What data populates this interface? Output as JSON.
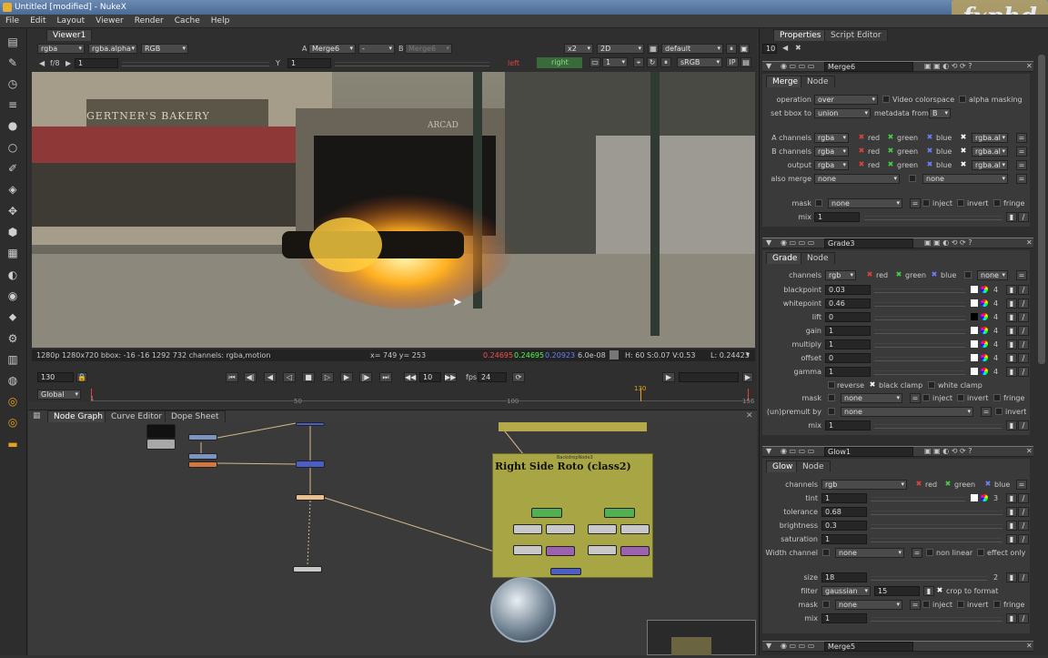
{
  "title": "Untitled [modified] - NukeX",
  "menu": [
    "File",
    "Edit",
    "Layout",
    "Viewer",
    "Render",
    "Cache",
    "Help"
  ],
  "watermark": "fxphd",
  "viewer": {
    "tab": "Viewer1",
    "channels": "rgba",
    "alpha": "rgba.alpha",
    "display": "RGB",
    "a_label": "A",
    "a_input": "Merge6",
    "b_dash": "-",
    "b_label": "B",
    "b_input": "Merge6",
    "zoom": "x2",
    "mode": "2D",
    "lut": "default",
    "fstop": "f/8",
    "frame_field": "1",
    "y_label": "Y",
    "y_value": "1",
    "left_eye": "left",
    "right_eye": "right",
    "frame_step": "1",
    "colorspace": "sRGB",
    "ip_label": "IP",
    "status_format": "1280p 1280x720 bbox: -16 -16 1292 732 channels: rgba,motion",
    "status_coords": "x= 749 y= 253",
    "status_r": "0.24695",
    "status_g": "0.24695",
    "status_b": "0.20923",
    "status_a": "6.0e-08",
    "status_hsv": "H: 60 S:0.07 V:0.53",
    "status_l": "L: 0.24423",
    "sign_text": "GERTNER'S BAKERY",
    "arcade_text": "ARCAD"
  },
  "timeline": {
    "frame": "130",
    "step": "10",
    "fps_label": "fps",
    "fps": "24",
    "range_mode": "Global",
    "ticks": [
      "1",
      "50",
      "100",
      "130",
      "156"
    ]
  },
  "nodegraph": {
    "tabs": [
      "Node Graph",
      "Curve Editor",
      "Dope Sheet"
    ],
    "backdrop_title": "Right Side Roto (class2)",
    "backdrop_small": "BackdropNode3"
  },
  "properties": {
    "tabs": [
      "Properties",
      "Script Editor"
    ],
    "max_panels": "10",
    "merge": {
      "name": "Merge6",
      "tabs": [
        "Merge",
        "Node"
      ],
      "operation_label": "operation",
      "operation": "over",
      "video_colorspace": "Video colorspace",
      "alpha_masking": "alpha masking",
      "setbbox_label": "set bbox to",
      "setbbox": "union",
      "metadata_label": "metadata from",
      "metadata": "B",
      "a_channels_label": "A channels",
      "b_channels_label": "B channels",
      "output_label": "output",
      "channels_value": "rgba",
      "red": "red",
      "green": "green",
      "blue": "blue",
      "alpha_ch": "rgba.al",
      "also_merge_label": "also merge",
      "also_merge": "none",
      "also_merge2": "none",
      "mask_label": "mask",
      "mask": "none",
      "inject": "inject",
      "invert": "invert",
      "fringe": "fringe",
      "mix_label": "mix",
      "mix": "1"
    },
    "grade": {
      "name": "Grade3",
      "tabs": [
        "Grade",
        "Node"
      ],
      "channels_label": "channels",
      "channels": "rgb",
      "red": "red",
      "green": "green",
      "blue": "blue",
      "none": "none",
      "rows": [
        {
          "label": "blackpoint",
          "value": "0.03"
        },
        {
          "label": "whitepoint",
          "value": "0.46"
        },
        {
          "label": "lift",
          "value": "0"
        },
        {
          "label": "gain",
          "value": "1"
        },
        {
          "label": "multiply",
          "value": "1"
        },
        {
          "label": "offset",
          "value": "0"
        },
        {
          "label": "gamma",
          "value": "1"
        }
      ],
      "count": "4",
      "reverse": "reverse",
      "black_clamp": "black clamp",
      "white_clamp": "white clamp",
      "mask_label": "mask",
      "mask": "none",
      "inject": "inject",
      "invert": "invert",
      "fringe": "fringe",
      "premult_label": "(un)premult by",
      "premult": "none",
      "invert2": "invert",
      "mix_label": "mix",
      "mix": "1"
    },
    "glow": {
      "name": "Glow1",
      "tabs": [
        "Glow",
        "Node"
      ],
      "channels_label": "channels",
      "channels": "rgb",
      "red": "red",
      "green": "green",
      "blue": "blue",
      "tint_label": "tint",
      "tint": "1",
      "tint_count": "3",
      "tolerance_label": "tolerance",
      "tolerance": "0.68",
      "brightness_label": "brightness",
      "brightness": "0.3",
      "saturation_label": "saturation",
      "saturation": "1",
      "width_channel_label": "Width channel",
      "width_channel": "none",
      "non_linear": "non linear",
      "effect_only": "effect only",
      "size_label": "size",
      "size": "18",
      "size_count": "2",
      "filter_label": "filter",
      "filter": "gaussian",
      "filter_value": "15",
      "crop": "crop to format",
      "mask_label": "mask",
      "mask": "none",
      "inject": "inject",
      "invert": "invert",
      "fringe": "fringe",
      "mix_label": "mix",
      "mix": "1"
    },
    "next_panel": "Merge5"
  }
}
